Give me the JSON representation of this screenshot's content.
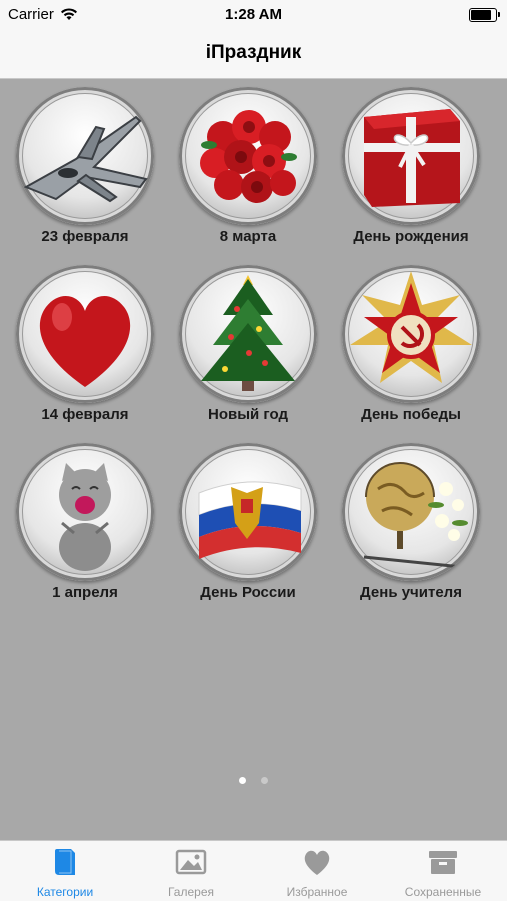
{
  "status": {
    "carrier": "Carrier",
    "time": "1:28 AM",
    "battery_level": 0.9
  },
  "nav": {
    "title": "iПраздник"
  },
  "categories": [
    {
      "label": "23 февраля",
      "icon": "fighter-jet-icon"
    },
    {
      "label": "8 марта",
      "icon": "roses-bouquet-icon"
    },
    {
      "label": "День рождения",
      "icon": "gift-box-icon"
    },
    {
      "label": "14 февраля",
      "icon": "heart-icon"
    },
    {
      "label": "Новый год",
      "icon": "christmas-tree-icon"
    },
    {
      "label": "День победы",
      "icon": "order-star-icon"
    },
    {
      "label": "1 апреля",
      "icon": "laughing-kitten-icon"
    },
    {
      "label": "День России",
      "icon": "russian-flag-icon"
    },
    {
      "label": "День учителя",
      "icon": "globe-flowers-icon"
    }
  ],
  "pager": {
    "page_count": 2,
    "current_page": 1
  },
  "tabs": [
    {
      "label": "Категории",
      "icon": "book-icon",
      "active": true
    },
    {
      "label": "Галерея",
      "icon": "picture-icon",
      "active": false
    },
    {
      "label": "Избранное",
      "icon": "heart-icon",
      "active": false
    },
    {
      "label": "Сохраненные",
      "icon": "archive-box-icon",
      "active": false
    }
  ],
  "colors": {
    "accent": "#1e88e5",
    "inactive": "#9a9a9a",
    "background": "#a8a8a8",
    "bars": "#f7f7f7"
  }
}
